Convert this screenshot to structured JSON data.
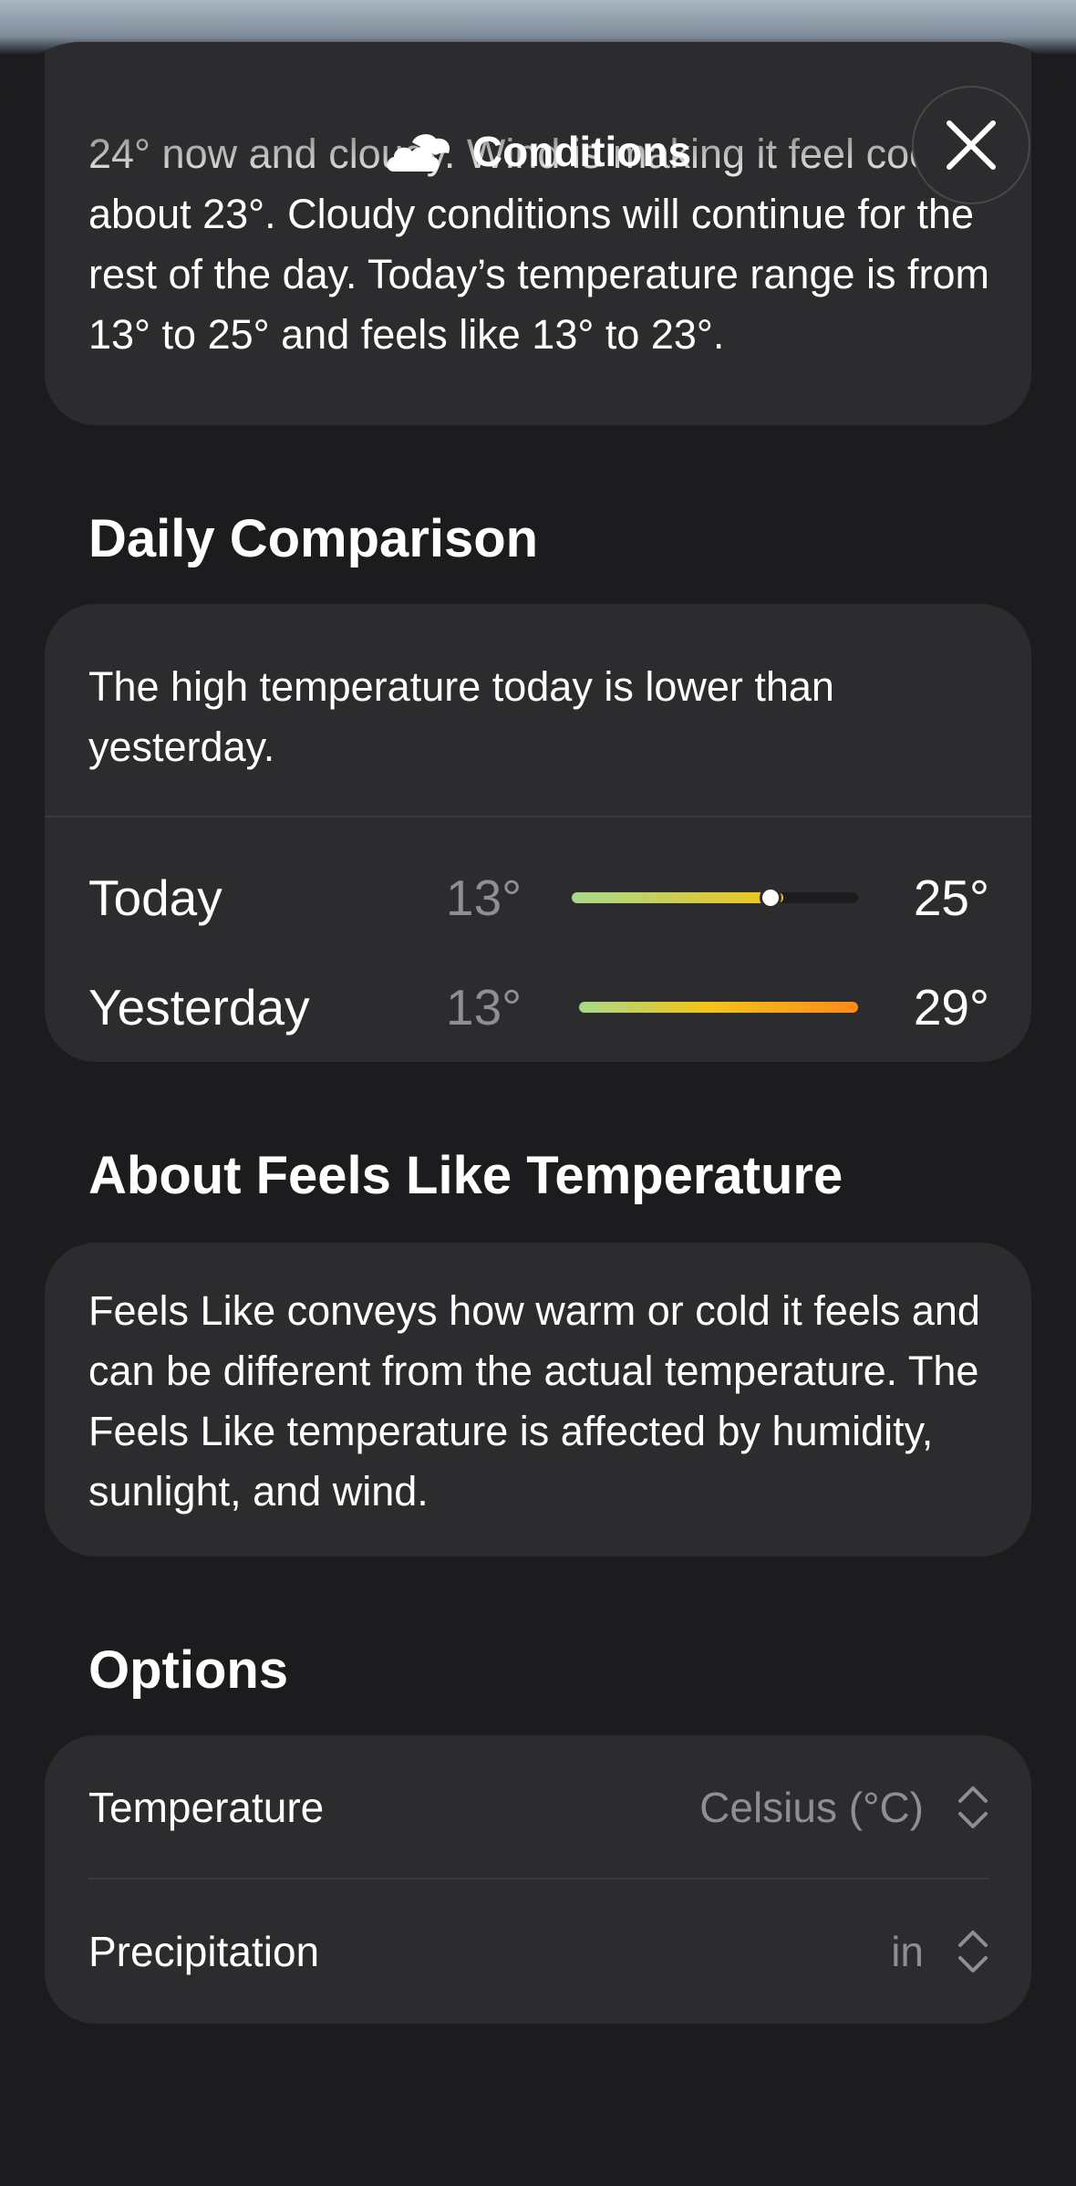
{
  "header": {
    "title": "Conditions",
    "icon": "cloud-icon",
    "close_icon": "close-icon"
  },
  "summary": {
    "text": "24° now and cloudy. Wind is making it feel cooler, about 23°. Cloudy conditions will continue for the rest of the day. Today’s temperature range is from 13° to 25° and feels like 13° to 23°."
  },
  "daily_comparison": {
    "title": "Daily Comparison",
    "description": "The high temperature today is lower than yesterday.",
    "rows": [
      {
        "label": "Today",
        "low": "13°",
        "high": "25°",
        "current_position": 0.69
      },
      {
        "label": "Yesterday",
        "low": "13°",
        "high": "29°"
      }
    ],
    "colors": {
      "cool": "#a6d98a",
      "mid": "#f5c518",
      "warm": "#ff8a1a"
    }
  },
  "feels_like": {
    "title": "About Feels Like Temperature",
    "text": "Feels Like conveys how warm or cold it feels and can be different from the actual temperature. The Feels Like temperature is affected by humidity, sunlight, and wind."
  },
  "options": {
    "title": "Options",
    "items": [
      {
        "label": "Temperature",
        "value": "Celsius (°C)"
      },
      {
        "label": "Precipitation",
        "value": "in"
      }
    ]
  }
}
